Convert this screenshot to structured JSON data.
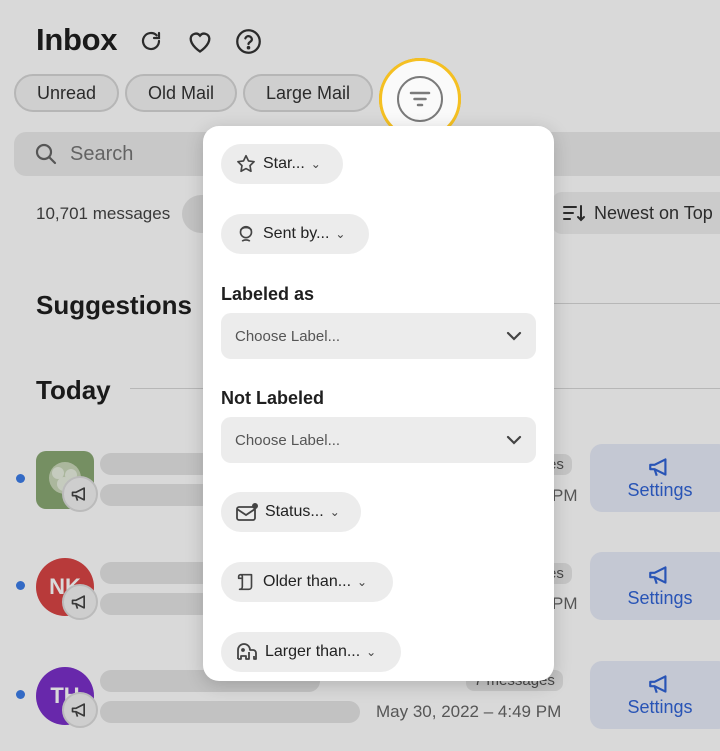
{
  "header": {
    "title": "Inbox"
  },
  "quick_filters": [
    "Unread",
    "Old Mail",
    "Large Mail"
  ],
  "search": {
    "placeholder": "Search"
  },
  "message_count": "10,701 messages",
  "sort_label": "Newest on Top",
  "sections": {
    "suggestions": "Suggestions",
    "today": "Today"
  },
  "rows": [
    {
      "avatar_text": "",
      "avatar_color": "#8aa874",
      "msgcount_partial": "es",
      "time_partial": "PM",
      "action": "Settings"
    },
    {
      "avatar_text": "NK",
      "avatar_color": "#d94545",
      "msgcount_partial": "es",
      "time_partial": "PM",
      "action": "Settings"
    },
    {
      "avatar_text": "TH",
      "avatar_color": "#7b2fc9",
      "msgcount_partial": "7 messages",
      "time_partial": "May 30, 2022 – 4:49 PM",
      "action": "Settings"
    }
  ],
  "filter_menu": {
    "starred": "Star...",
    "sent_by": "Sent by...",
    "labeled_title": "Labeled as",
    "labeled_value": "Choose Label...",
    "not_labeled_title": "Not Labeled",
    "not_labeled_value": "Choose Label...",
    "status": "Status...",
    "older": "Older than...",
    "larger": "Larger than..."
  },
  "colors": {
    "accent": "#f5c022",
    "link": "#2f63d6",
    "unread_dot": "#3d7de8"
  }
}
